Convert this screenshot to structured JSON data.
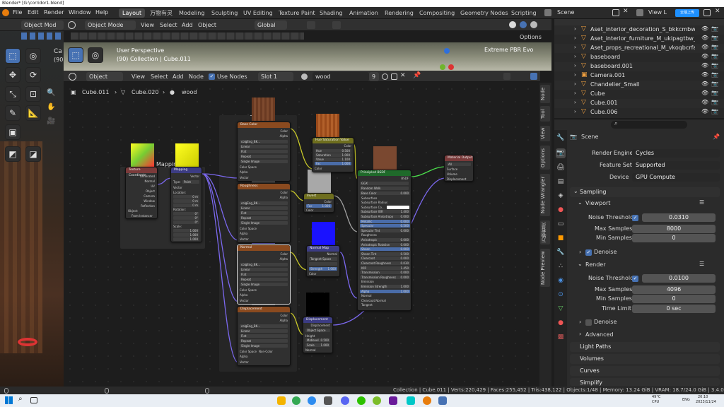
{
  "window_title": "Blender* [G:\\corridor1.blend]",
  "menu": [
    "File",
    "Edit",
    "Render",
    "Window",
    "Help"
  ],
  "workspaces": [
    "Layout",
    "万物有灵",
    "Modeling",
    "Sculpting",
    "UV Editing",
    "Texture Paint",
    "Shading",
    "Animation",
    "Rendering",
    "Compositing",
    "Geometry Nodes",
    "Scripting"
  ],
  "active_workspace": "Layout",
  "scene_name": "Scene",
  "view_layer": "View L",
  "upload_badge": "云端上传",
  "viewport": {
    "mode": "Object Mode",
    "menus": [
      "View",
      "Select",
      "Add",
      "Object"
    ],
    "transform": "Global",
    "options": "Options",
    "perspective": "User Perspective",
    "collection_info": "(90) Collection | Cube.011",
    "render_engine_badge": "Extreme PBR Evo",
    "left_mode": "Object Mod",
    "left_text1": "Ca",
    "left_text2": "(90"
  },
  "node_editor": {
    "type": "Object",
    "menus": [
      "View",
      "Select",
      "Add",
      "Node"
    ],
    "use_nodes": "Use Nodes",
    "slot": "Slot 1",
    "material": "wood",
    "users": "9",
    "breadcrumb": [
      "Cube.011",
      "Cube.020",
      "wood"
    ],
    "side_tabs": [
      "Node",
      "Tool",
      "View",
      "Options",
      "Node Wrangler",
      "万物有灵",
      "Node Preview"
    ]
  },
  "nodes": {
    "tex_coord": {
      "title": "Texture Coordinate",
      "outputs": [
        "Generated",
        "Normal",
        "UV",
        "Object",
        "Camera",
        "Window",
        "Reflection"
      ],
      "object_label": "Object:",
      "from_instancer": "From Instancer"
    },
    "mapping_frame": "Mapping",
    "mapping": {
      "title": "Mapping",
      "out": "Vector",
      "type_label": "Type:",
      "type": "Point",
      "vector": "Vector",
      "location": "Location:",
      "rotation": "Rotation:",
      "scale": "Scale:",
      "loc": [
        "0 m",
        "0 m",
        "0 m"
      ],
      "rot": [
        "0°",
        "0°",
        "0°"
      ],
      "scl": [
        "1.000",
        "1.000",
        "1.000"
      ]
    },
    "frame_label": "Te",
    "base_color": {
      "title": "Base Color",
      "img": "colgEng_BK...",
      "opts": [
        "Linear",
        "Flat",
        "Repeat",
        "Single Image"
      ],
      "space": "Color Space",
      "alpha": "Alpha",
      "vector": "Vector",
      "out1": "Color",
      "out2": "Alpha"
    },
    "roughness": {
      "title": "Roughness",
      "img": "colgEng_BK...",
      "opts": [
        "Linear",
        "Flat",
        "Repeat",
        "Single Image"
      ],
      "space": "Color Space",
      "alpha": "Alpha",
      "vector": "Vector",
      "out1": "Color",
      "out2": "Alpha"
    },
    "normal": {
      "title": "Normal",
      "img": "colgEng_BK...",
      "opts": [
        "Linear",
        "Flat",
        "Repeat",
        "Single Image"
      ],
      "space": "Color Space",
      "alpha": "Alpha",
      "vector": "Vector",
      "out1": "Color",
      "out2": "Alpha"
    },
    "displacement_tex": {
      "title": "Displacement",
      "img": "colgEng_BK...",
      "opts": [
        "Linear",
        "Flat",
        "Repeat",
        "Single Image"
      ],
      "space": "Color Space",
      "space_val": "Non-Color",
      "alpha": "Alpha",
      "vector": "Vector",
      "out1": "Color",
      "out2": "Alpha"
    },
    "hsv": {
      "title": "Hue Saturation Value",
      "out": "Color",
      "rows": [
        [
          "Hue",
          "0.500"
        ],
        [
          "Saturation",
          "1.000"
        ],
        [
          "Value",
          "1.100"
        ],
        [
          "Fac",
          "1.000"
        ]
      ],
      "color": "Color"
    },
    "invert": {
      "title": "Invert",
      "out": "Color",
      "fac": "Fac",
      "fac_val": "1.000",
      "color": "Color"
    },
    "normal_map": {
      "title": "Normal Map",
      "out": "Normal",
      "space": "Tangent Space",
      "strength": "Strength",
      "strength_val": "1.000",
      "color": "Color"
    },
    "displacement": {
      "title": "Displacement",
      "out": "Displacement",
      "space": "Object Space",
      "inputs": [
        "Height",
        "Midlevel",
        "Scale",
        "Normal"
      ],
      "mid": "0.500",
      "scale": "1.000"
    },
    "principled": {
      "title": "Principled BSDF",
      "out": "BSDF",
      "dist": "GGX",
      "sss": "Random Walk",
      "inputs": [
        "Base Color",
        "Subsurface",
        "Subsurface Radius",
        "Subsurface Co...",
        "Subsurface IOR",
        "Subsurface Anisotropy",
        "Metallic",
        "Specular",
        "Specular Tint",
        "Roughness",
        "Anisotropic",
        "Anisotropic Rotation",
        "Sheen",
        "Sheen Tint",
        "Clearcoat",
        "Clearcoat Roughness",
        "IOR",
        "Transmission",
        "Transmission Roughness",
        "Emission",
        "Emission Strength",
        "Alpha",
        "Normal",
        "Clearcoat Normal",
        "Tangent"
      ],
      "values": [
        "0.000",
        "",
        "",
        "",
        "1.400",
        "0.000",
        "0.000",
        "0.500",
        "0.000",
        "",
        "0.000",
        "0.000",
        "0.000",
        "0.500",
        "0.000",
        "0.030",
        "1.450",
        "0.000",
        "0.000",
        "",
        "1.000",
        "1.000",
        "",
        "",
        ""
      ]
    },
    "material_output": {
      "title": "Material Output",
      "target": "All",
      "inputs": [
        "Surface",
        "Volume",
        "Displacement"
      ]
    }
  },
  "outliner": [
    {
      "name": "Aset_interior_decoration_S_bkkcmbw_L",
      "icon": "triangle-icon"
    },
    {
      "name": "Aset_interior_furniture_M_ukipagtbw_LO",
      "icon": "triangle-icon"
    },
    {
      "name": "Aset_props_recreational_M_vkoqbcrfa_LC",
      "icon": "triangle-icon"
    },
    {
      "name": "baseboard",
      "icon": "triangle-icon"
    },
    {
      "name": "baseboard.001",
      "icon": "triangle-icon"
    },
    {
      "name": "Camera.001",
      "icon": "camera-icon"
    },
    {
      "name": "Chandelier_Small",
      "icon": "triangle-icon"
    },
    {
      "name": "Cube",
      "icon": "triangle-icon"
    },
    {
      "name": "Cube.001",
      "icon": "triangle-icon"
    },
    {
      "name": "Cube.006",
      "icon": "triangle-icon"
    }
  ],
  "properties": {
    "scene": "Scene",
    "render_engine_label": "Render Engine",
    "render_engine": "Cycles",
    "feature_set_label": "Feature Set",
    "feature_set": "Supported",
    "device_label": "Device",
    "device": "GPU Compute",
    "sampling": "Sampling",
    "viewport": "Viewport",
    "noise_threshold_label": "Noise Threshold",
    "vp_noise": "0.0310",
    "max_samples_label": "Max Samples",
    "vp_max": "8000",
    "min_samples_label": "Min Samples",
    "vp_min": "0",
    "denoise": "Denoise",
    "render": "Render",
    "r_noise": "0.0100",
    "r_max": "4096",
    "r_min": "0",
    "time_limit_label": "Time Limit",
    "time_limit": "0 sec",
    "advanced": "Advanced",
    "light_paths": "Light Paths",
    "volumes": "Volumes",
    "curves": "Curves",
    "simplify": "Simplify"
  },
  "status": "Collection | Cube.011 | Verts:220,429 | Faces:255,452 | Tris:438,122 | Objects:1/48 | Memory: 13.24 GiB | VRAM: 18.7/24.0 GiB | 3.4.0",
  "taskbar": {
    "time": "20:10",
    "date": "2023/11/24",
    "temp": "49°C",
    "cpu": "CPU",
    "lang": "ENG"
  }
}
